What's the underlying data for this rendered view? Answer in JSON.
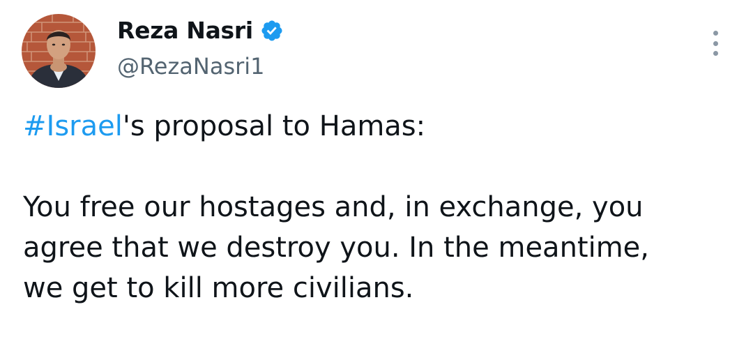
{
  "author": {
    "name": "Reza Nasri",
    "handle": "@RezaNasri1",
    "verified_icon": "verified-badge",
    "verified_color": "#1d9bf0"
  },
  "more_icon": "more-vertical",
  "tweet": {
    "hashtag": "#Israel",
    "line1_rest": "'s proposal to Hamas:",
    "para2_line1": "You free our hostages and, in exchange, you",
    "para2_line2": "agree that we destroy you. In the meantime,",
    "para2_line3": "we get to kill more civilians."
  },
  "colors": {
    "text": "#0f1419",
    "secondary": "#536471",
    "link": "#1d9bf0"
  }
}
